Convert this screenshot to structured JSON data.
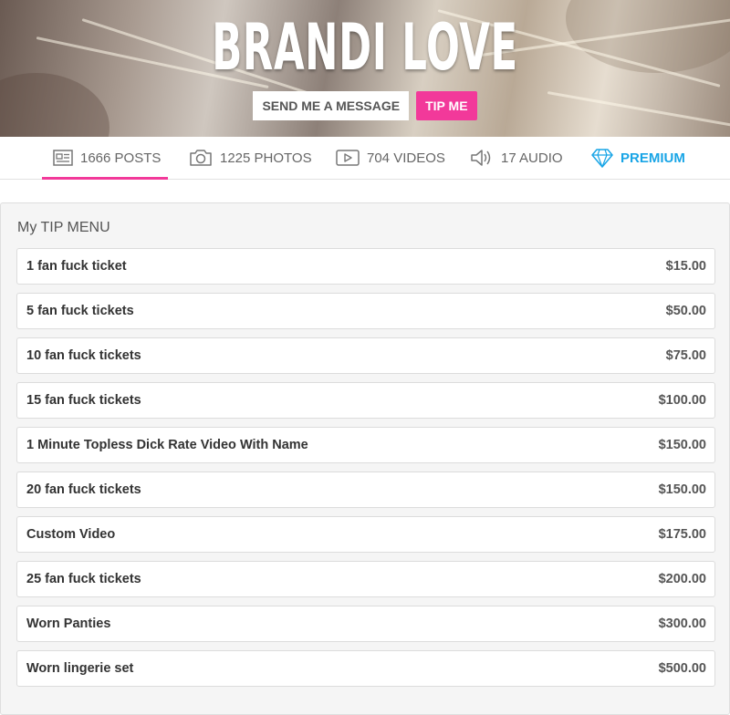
{
  "header": {
    "title": "BRANDI LOVE",
    "send_message_label": "SEND ME A MESSAGE",
    "tip_label": "TIP ME",
    "accent_color": "#f2399a"
  },
  "tabs": [
    {
      "label": "1666 POSTS",
      "icon": "posts-icon",
      "active": true
    },
    {
      "label": "1225 PHOTOS",
      "icon": "camera-icon"
    },
    {
      "label": "704 VIDEOS",
      "icon": "video-play-icon"
    },
    {
      "label": "17 AUDIO",
      "icon": "speaker-icon"
    },
    {
      "label": "PREMIUM",
      "icon": "diamond-icon",
      "color": "#19a5e6"
    }
  ],
  "tip_menu": {
    "title": "My TIP MENU",
    "items": [
      {
        "name": "1 fan fuck ticket",
        "price": "$15.00"
      },
      {
        "name": "5 fan fuck tickets",
        "price": "$50.00"
      },
      {
        "name": "10 fan fuck tickets",
        "price": "$75.00"
      },
      {
        "name": "15 fan fuck tickets",
        "price": "$100.00"
      },
      {
        "name": "1 Minute Topless Dick Rate Video With Name",
        "price": "$150.00"
      },
      {
        "name": "20 fan fuck tickets",
        "price": "$150.00"
      },
      {
        "name": "Custom Video",
        "price": "$175.00"
      },
      {
        "name": "25 fan fuck tickets",
        "price": "$200.00"
      },
      {
        "name": "Worn Panties",
        "price": "$300.00"
      },
      {
        "name": "Worn lingerie set",
        "price": "$500.00"
      }
    ]
  }
}
